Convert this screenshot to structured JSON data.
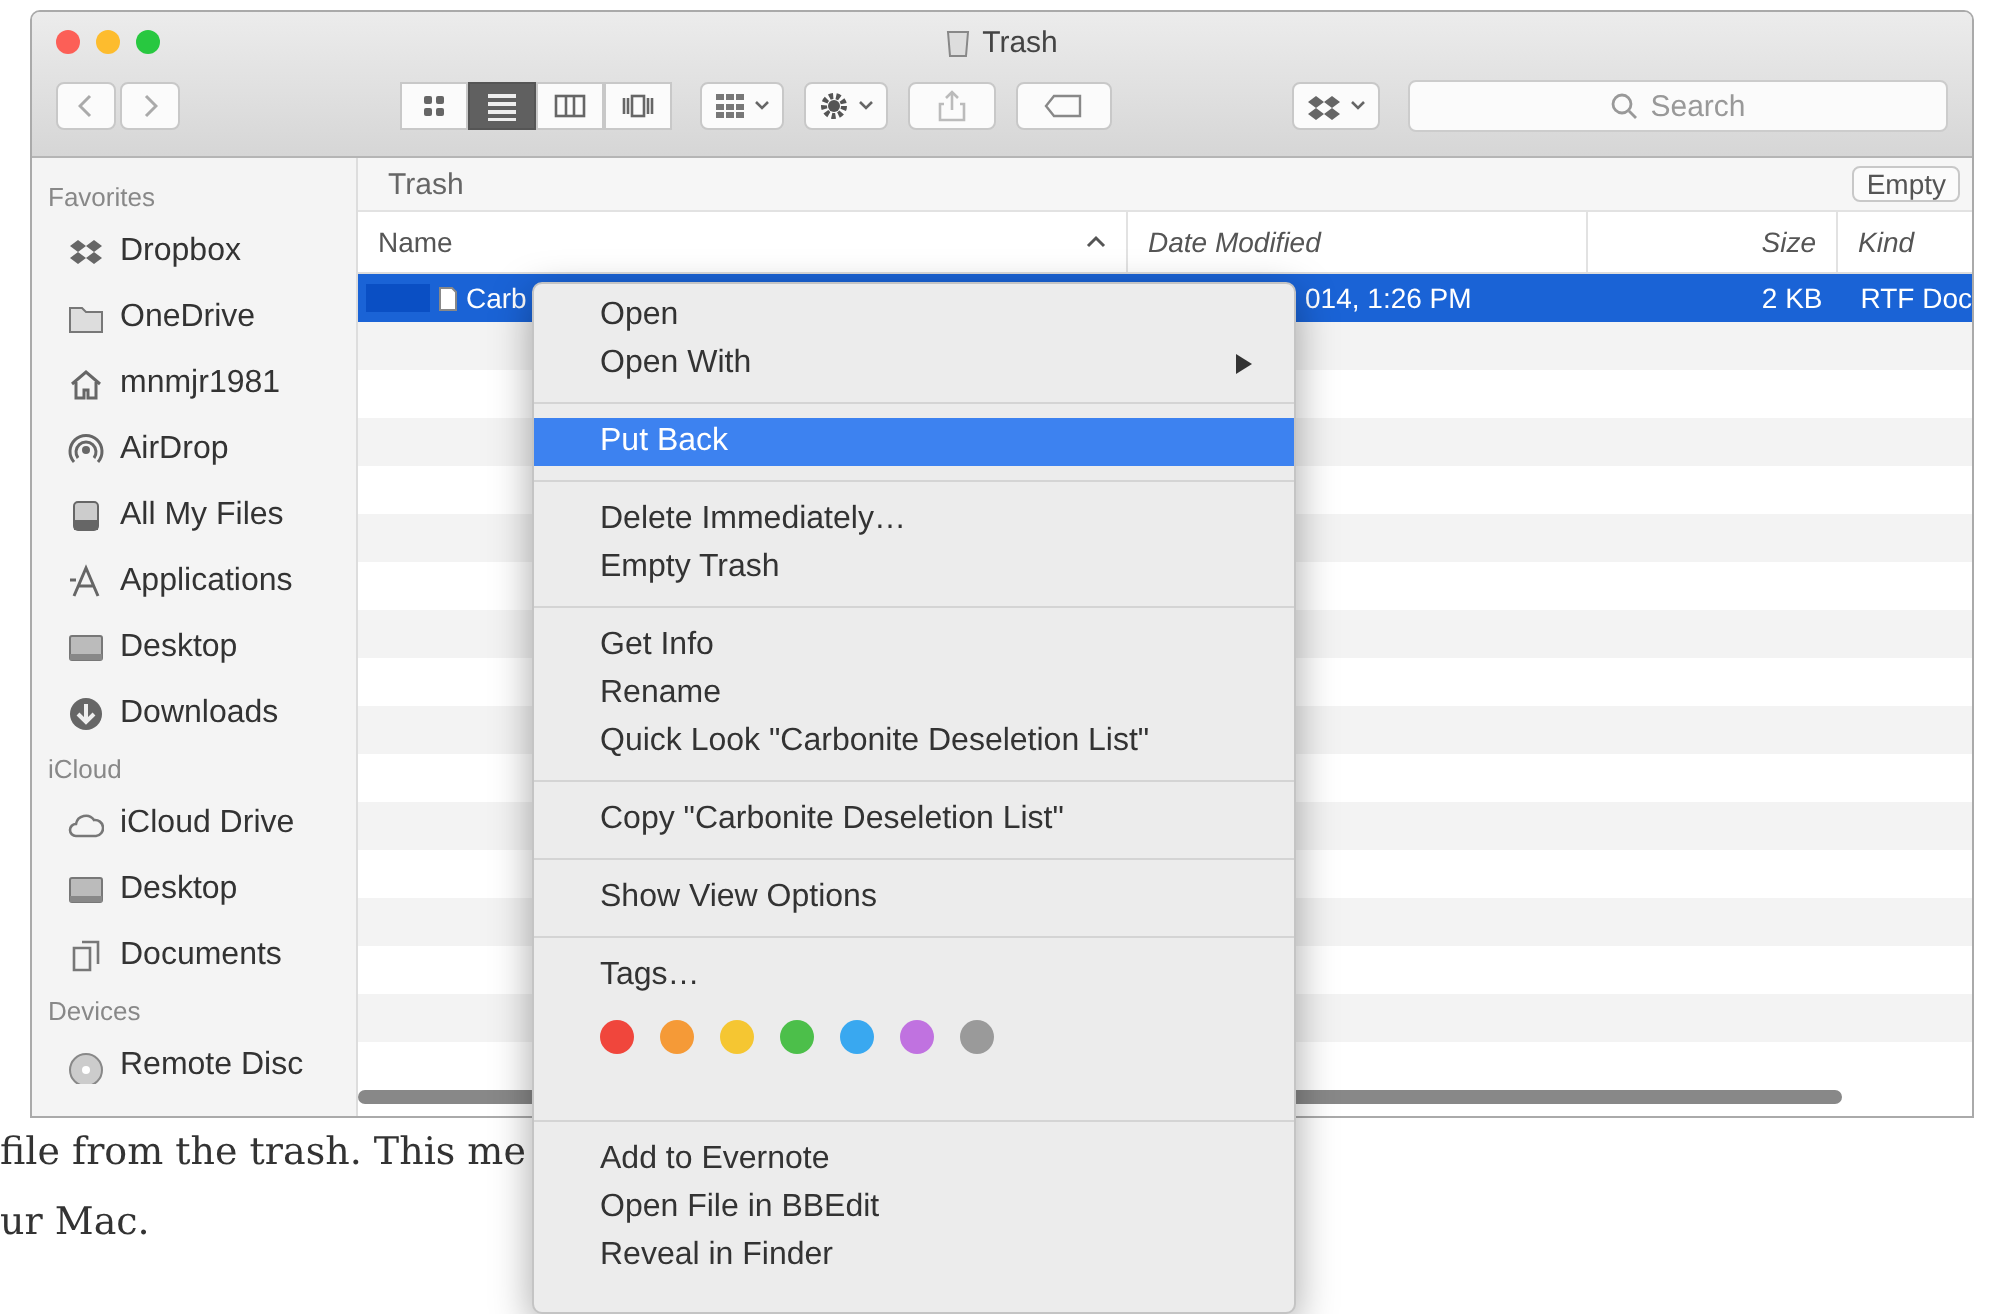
{
  "window": {
    "title": "Trash"
  },
  "toolbar": {
    "view_buttons": [
      {
        "kind": "icons",
        "selected": false
      },
      {
        "kind": "list",
        "selected": true
      },
      {
        "kind": "columns",
        "selected": false
      },
      {
        "kind": "coverflow",
        "selected": false
      }
    ],
    "search": {
      "placeholder": "Search"
    }
  },
  "sidebar": {
    "sections": [
      {
        "header": "Favorites",
        "items": [
          {
            "label": "Dropbox",
            "kind": "dropbox"
          },
          {
            "label": "OneDrive",
            "kind": "folder"
          },
          {
            "label": "mnmjr1981",
            "kind": "home"
          },
          {
            "label": "AirDrop",
            "kind": "airdrop"
          },
          {
            "label": "All My Files",
            "kind": "files"
          },
          {
            "label": "Applications",
            "kind": "apps"
          },
          {
            "label": "Desktop",
            "kind": "desktop"
          },
          {
            "label": "Downloads",
            "kind": "downloads"
          }
        ]
      },
      {
        "header": "iCloud",
        "items": [
          {
            "label": "iCloud Drive",
            "kind": "cloud"
          },
          {
            "label": "Desktop",
            "kind": "desktop"
          },
          {
            "label": "Documents",
            "kind": "documents"
          }
        ]
      },
      {
        "header": "Devices",
        "items": [
          {
            "label": "Remote Disc",
            "kind": "disc"
          }
        ]
      }
    ]
  },
  "path_bar": {
    "label": "Trash",
    "empty_button": "Empty"
  },
  "table": {
    "columns": [
      {
        "label": "Name",
        "sorted": true
      },
      {
        "label": "Date Modified",
        "sorted": false
      },
      {
        "label": "Size",
        "sorted": false
      },
      {
        "label": "Kind",
        "sorted": false
      }
    ],
    "rows": [
      {
        "name": "Carb",
        "date": "014, 1:26 PM",
        "size": "2 KB",
        "kind": "RTF Doc",
        "selected": true
      }
    ]
  },
  "context_menu": {
    "groups": [
      {
        "kind": "items",
        "items": [
          {
            "label": "Open",
            "submenu": false,
            "selected": false
          },
          {
            "label": "Open With",
            "submenu": true,
            "selected": false
          }
        ]
      },
      {
        "kind": "items",
        "items": [
          {
            "label": "Put Back",
            "submenu": false,
            "selected": true
          }
        ]
      },
      {
        "kind": "items",
        "items": [
          {
            "label": "Delete Immediately…",
            "submenu": false,
            "selected": false
          },
          {
            "label": "Empty Trash",
            "submenu": false,
            "selected": false
          }
        ]
      },
      {
        "kind": "items",
        "items": [
          {
            "label": "Get Info",
            "submenu": false,
            "selected": false
          },
          {
            "label": "Rename",
            "submenu": false,
            "selected": false
          },
          {
            "label": "Quick Look \"Carbonite Deseletion List\"",
            "submenu": false,
            "selected": false
          }
        ]
      },
      {
        "kind": "items",
        "items": [
          {
            "label": "Copy \"Carbonite Deseletion List\"",
            "submenu": false,
            "selected": false
          }
        ]
      },
      {
        "kind": "items",
        "items": [
          {
            "label": "Show View Options",
            "submenu": false,
            "selected": false
          }
        ]
      },
      {
        "kind": "tags",
        "label": "Tags…",
        "tags": [
          {
            "color": "#f0463c"
          },
          {
            "color": "#f59a37"
          },
          {
            "color": "#f5c632"
          },
          {
            "color": "#4cbf4a"
          },
          {
            "color": "#39a8f0"
          },
          {
            "color": "#c072e0"
          },
          {
            "color": "#9a9a9a"
          }
        ]
      },
      {
        "kind": "items",
        "items": [
          {
            "label": "Add to Evernote",
            "submenu": false,
            "selected": false
          },
          {
            "label": "Open File in BBEdit",
            "submenu": false,
            "selected": false
          },
          {
            "label": "Reveal in Finder",
            "submenu": false,
            "selected": false
          }
        ]
      }
    ]
  },
  "article": {
    "lines": [
      "file from the trash. This me",
      "ur Mac."
    ]
  }
}
